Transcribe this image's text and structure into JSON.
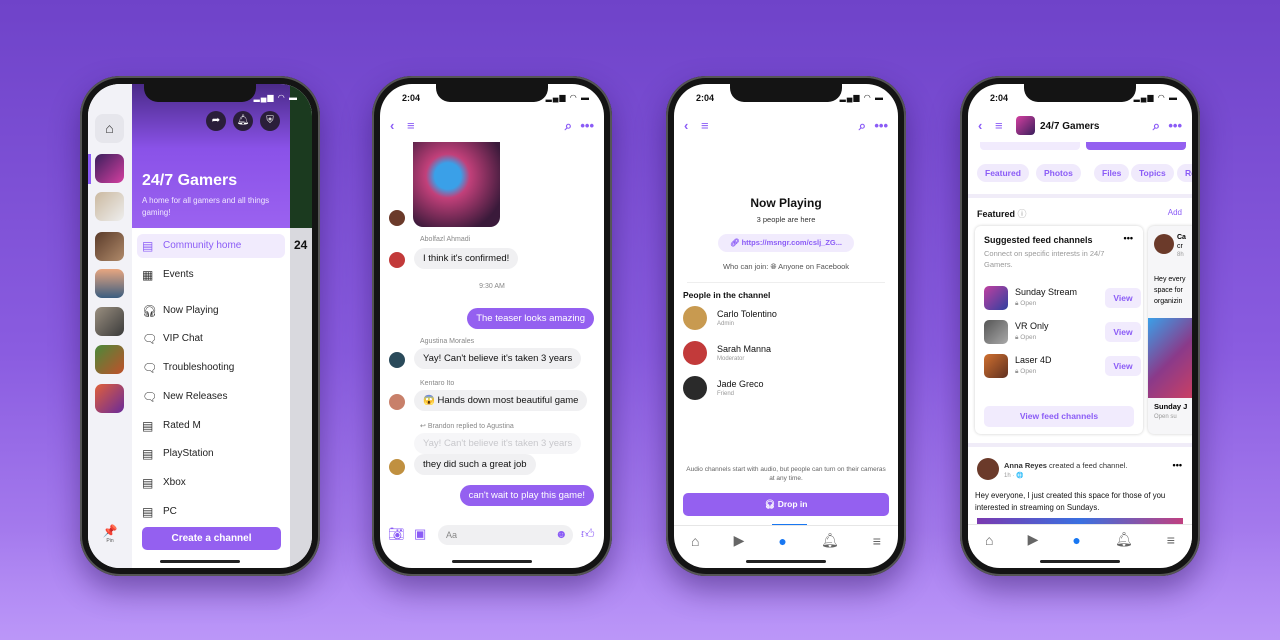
{
  "colors": {
    "accent": "#8b5cf6",
    "button": "#9460f0",
    "active_tab": "#1877f2",
    "background": "#7a4fd6"
  },
  "status_time": "2:04",
  "phone1": {
    "community_name": "24/7 Gamers",
    "description": "A home for all gamers and all things gaming!",
    "header_icons": [
      "share-icon",
      "bell-icon",
      "shield-icon"
    ],
    "menu": [
      {
        "label": "Community home",
        "icon": "community-home-icon",
        "active": true
      },
      {
        "label": "Events",
        "icon": "calendar-icon"
      },
      {
        "label": "Now Playing",
        "icon": "headphones-icon"
      },
      {
        "label": "VIP Chat",
        "icon": "locked-chat-icon"
      },
      {
        "label": "Troubleshooting",
        "icon": "chat-globe-icon"
      },
      {
        "label": "New Releases",
        "icon": "chat-globe-icon"
      },
      {
        "label": "Rated M",
        "icon": "locked-channel-icon"
      },
      {
        "label": "PlayStation",
        "icon": "channel-globe-icon"
      },
      {
        "label": "Xbox",
        "icon": "channel-globe-icon"
      },
      {
        "label": "PC",
        "icon": "channel-globe-icon"
      }
    ],
    "create_button": "Create a channel",
    "pin_label": "Pin",
    "peek_title": "24"
  },
  "phone2": {
    "messages": [
      {
        "sender": "Abolfazl Ahmadi",
        "text": "I think it's confirmed!"
      },
      {
        "timestamp": "9:30 AM"
      },
      {
        "outgoing": true,
        "text": "The teaser looks amazing"
      },
      {
        "sender": "Agustina Morales",
        "text": "Yay! Can't believe it's taken 3 years"
      },
      {
        "sender": "Kentaro Ito",
        "text": "😱 Hands down most beautiful game"
      },
      {
        "reply_label": "Brandon replied to Agustina",
        "quoted": "Yay! Can't believe it's taken 3 years",
        "text": "they did such a great job"
      },
      {
        "outgoing": true,
        "text": "can't wait to play this game!"
      }
    ],
    "composer_placeholder": "Aa"
  },
  "phone3": {
    "title": "Now Playing",
    "count": "3 people are here",
    "link": "https://msngr.com/cslj_ZG...",
    "who_can_join_label": "Who can join:",
    "who_can_join_value": "Anyone on Facebook",
    "people_heading": "People in the channel",
    "people": [
      {
        "name": "Carlo Tolentino",
        "role": "Admin"
      },
      {
        "name": "Sarah Manna",
        "role": "Moderator"
      },
      {
        "name": "Jade Greco",
        "role": "Friend"
      }
    ],
    "footer_note": "Audio channels start with audio, but people can turn on their cameras at any time.",
    "drop_in": "Drop in"
  },
  "phone4": {
    "title": "24/7 Gamers",
    "chips": [
      "Featured",
      "Photos",
      "Files",
      "Topics",
      "Re"
    ],
    "featured_label": "Featured",
    "add_label": "Add",
    "card_title": "Suggested feed channels",
    "card_sub": "Connect on specific interests in 24/7 Gamers.",
    "channels": [
      {
        "name": "Sunday Stream",
        "status": "Open",
        "action": "View"
      },
      {
        "name": "VR Only",
        "status": "Open",
        "action": "View"
      },
      {
        "name": "Laser 4D",
        "status": "Open",
        "action": "View"
      }
    ],
    "view_all": "View feed channels",
    "peek_card": {
      "name": "Ca",
      "line": "cr",
      "time": "8h",
      "text": "Hey every space for organizin",
      "footer": "Sunday J",
      "footer_sub": "Open su"
    },
    "post": {
      "author": "Anna Reyes",
      "action": "created a feed channel.",
      "time": "1h · 🌐",
      "text": "Hey everyone, I just created this space for those of you interested in streaming on Sundays."
    }
  }
}
